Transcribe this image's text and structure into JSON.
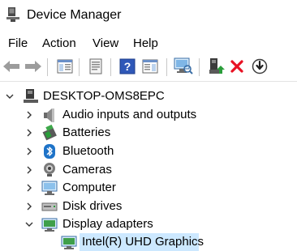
{
  "window": {
    "title": "Device Manager",
    "title_icon": "device-manager-icon"
  },
  "menu": {
    "items": [
      "File",
      "Action",
      "View",
      "Help"
    ]
  },
  "toolbar": {
    "buttons": [
      "back-arrow-icon",
      "forward-arrow-icon",
      "show-hide-console-tree-icon",
      "properties-icon",
      "help-icon",
      "action-pane-icon",
      "scan-hardware-changes-icon",
      "update-driver-icon",
      "uninstall-device-icon",
      "disable-device-icon"
    ]
  },
  "tree": {
    "root": {
      "label": "DESKTOP-OMS8EPC",
      "expanded": true,
      "icon": "computer-icon"
    },
    "categories": [
      {
        "label": "Audio inputs and outputs",
        "icon": "speaker-icon",
        "expanded": false
      },
      {
        "label": "Batteries",
        "icon": "battery-icon",
        "expanded": false
      },
      {
        "label": "Bluetooth",
        "icon": "bluetooth-icon",
        "expanded": false
      },
      {
        "label": "Cameras",
        "icon": "camera-icon",
        "expanded": false
      },
      {
        "label": "Computer",
        "icon": "monitor-icon",
        "expanded": false
      },
      {
        "label": "Disk drives",
        "icon": "disk-drive-icon",
        "expanded": false
      },
      {
        "label": "Display adapters",
        "icon": "display-adapter-icon",
        "expanded": true
      }
    ],
    "children": {
      "display_adapters": [
        {
          "label": "Intel(R) UHD Graphics",
          "icon": "display-adapter-icon",
          "selected": true
        }
      ]
    }
  },
  "colors": {
    "selection": "#cce8ff",
    "accent_blue": "#1e73c8",
    "error_red": "#e81123",
    "green": "#2a9d3a"
  }
}
